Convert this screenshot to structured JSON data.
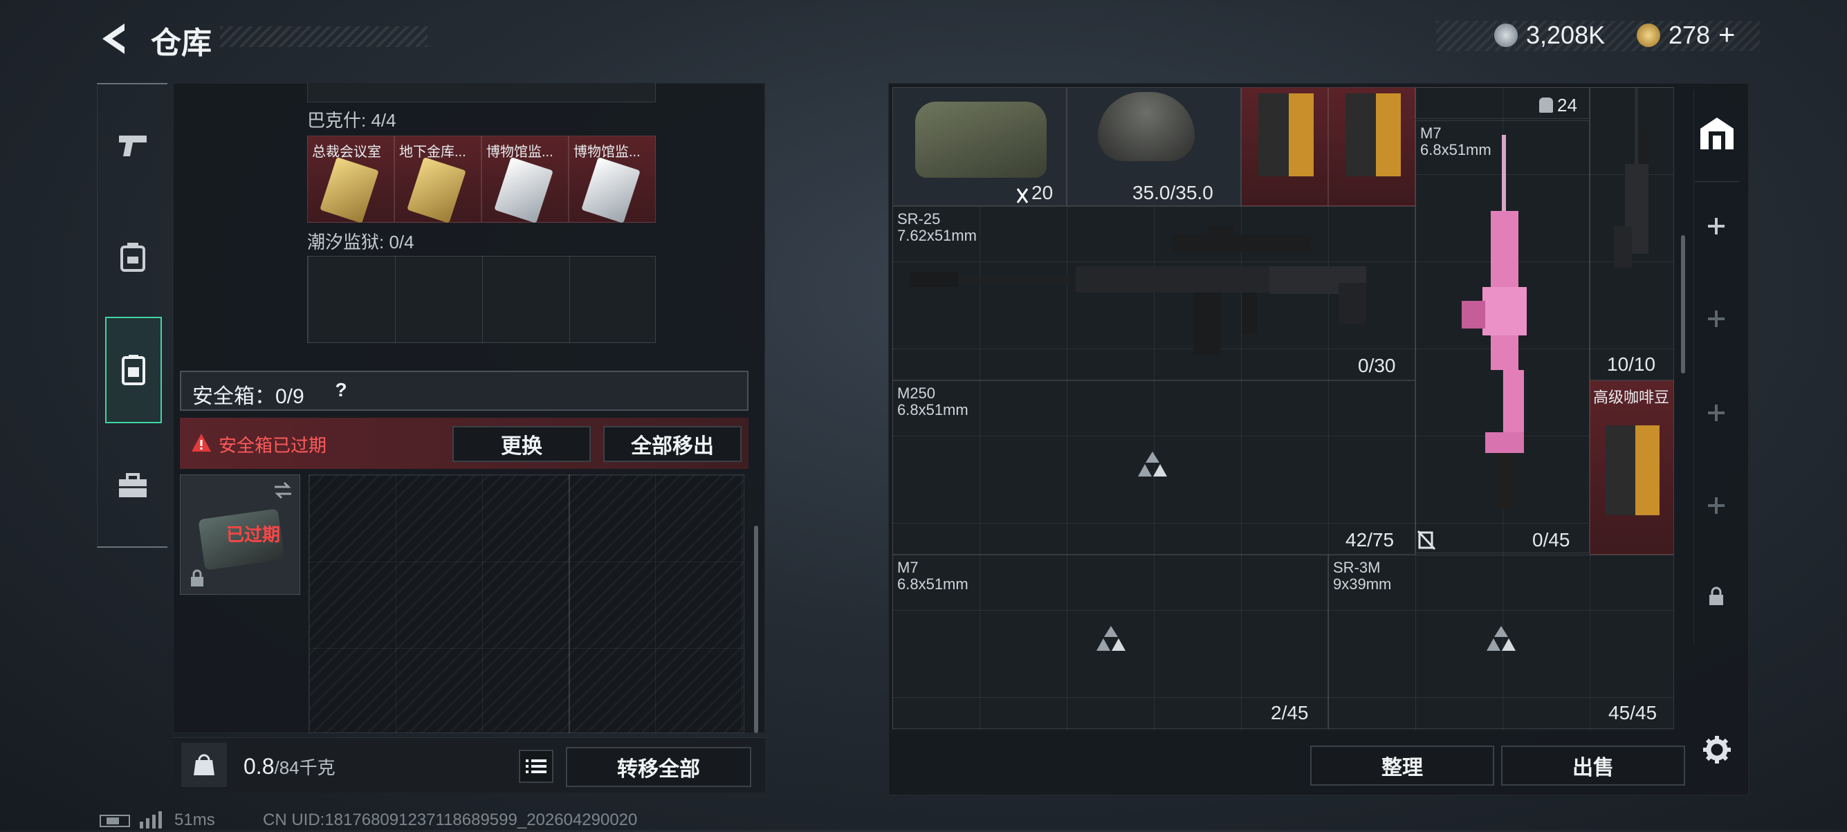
{
  "header": {
    "title": "仓库",
    "currency_amount": "3,208K",
    "premium_amount": "278",
    "premium_plus": "+"
  },
  "sidebar": {
    "items": [
      "pistol-tab",
      "backpack-tab",
      "safebox-tab",
      "toolbox-tab"
    ]
  },
  "left_panel": {
    "keycards_group": {
      "label": "巴克什: 4/4",
      "cards": [
        "总裁会议室",
        "地下金库...",
        "博物馆监...",
        "博物馆监..."
      ]
    },
    "prison_group": {
      "label": "潮汐监狱: 0/4"
    },
    "safebox": {
      "label": "安全箱：0/9",
      "help": "?",
      "warning": "安全箱已过期",
      "replace_btn": "更换",
      "remove_all_btn": "全部移出",
      "expired_tag": "已过期"
    },
    "footer": {
      "weight": "0.8",
      "weight_max": "/84千克",
      "transfer_all_btn": "转移全部"
    }
  },
  "status_bar": {
    "ping": "51ms",
    "uid": "CN UID:181768091237118689599_202604290020"
  },
  "stash": {
    "items": [
      {
        "id": "helmet",
        "count": "20"
      },
      {
        "id": "helmet2",
        "durability": "35.0/35.0"
      },
      {
        "id": "coffee1"
      },
      {
        "id": "coffee2"
      },
      {
        "id": "bag",
        "count": "24"
      },
      {
        "id": "m7_pink",
        "name": "M7",
        "caliber": "6.8x51mm",
        "ammo": "0/45"
      },
      {
        "id": "sr25",
        "name": "SR-25",
        "caliber": "7.62x51mm",
        "ammo": "0/30"
      },
      {
        "id": "sniper",
        "ammo": "10/10"
      },
      {
        "id": "m250",
        "name": "M250",
        "caliber": "6.8x51mm",
        "ammo": "42/75"
      },
      {
        "id": "coffee3",
        "name": "高级咖啡豆"
      },
      {
        "id": "m7",
        "name": "M7",
        "caliber": "6.8x51mm",
        "ammo": "2/45"
      },
      {
        "id": "sr3m",
        "name": "SR-3M",
        "caliber": "9x39mm",
        "ammo": "45/45"
      }
    ],
    "sort_btn": "整理",
    "sell_btn": "出售"
  },
  "colors": {
    "accent_green": "#3fd6a4",
    "warning_red": "#e23b3b",
    "expired_bg": "#5a2328"
  }
}
